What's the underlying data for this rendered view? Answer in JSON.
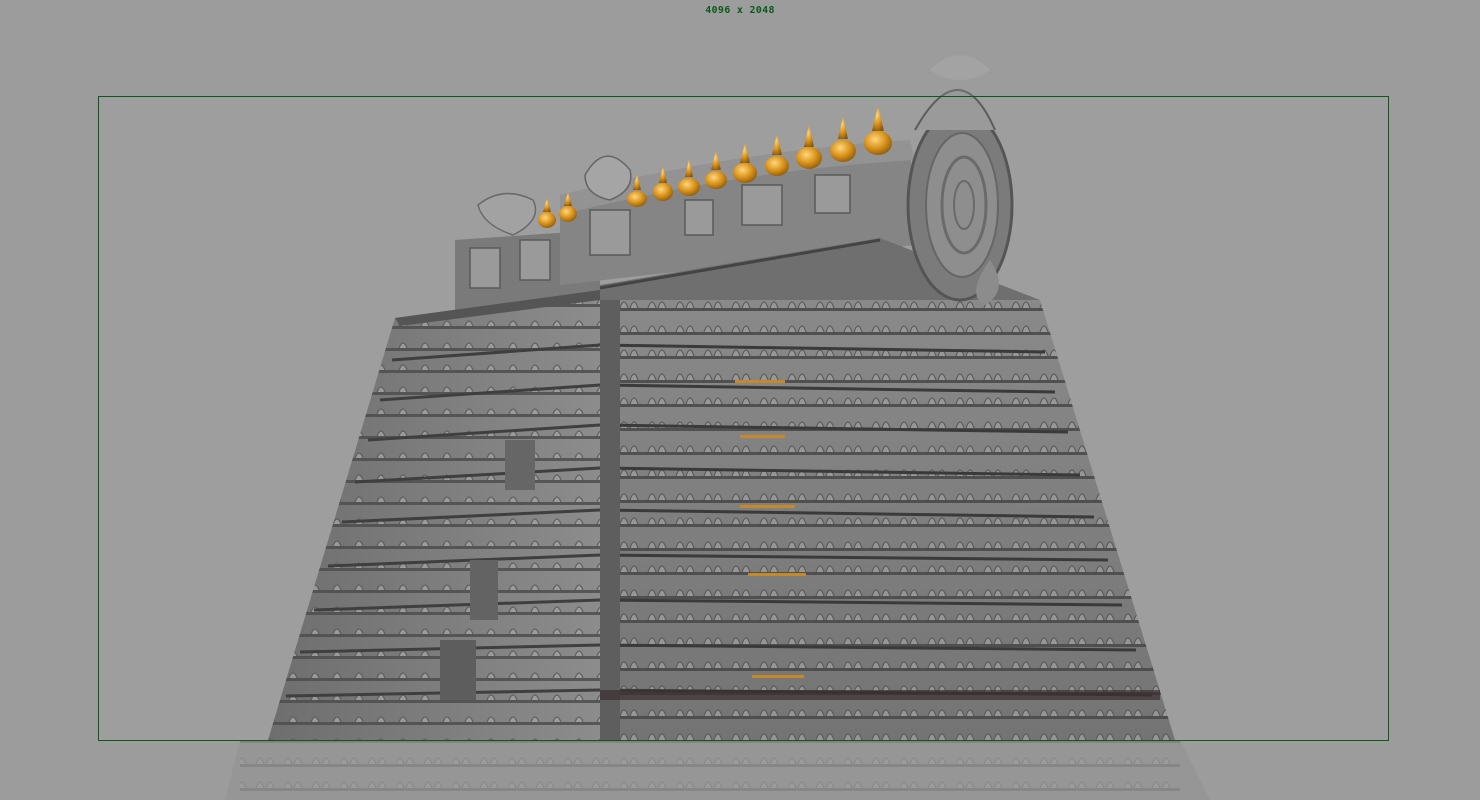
{
  "viewport": {
    "resolution_label": "4096 x 2048",
    "background_color": "#9e9e9e",
    "gate_color": "#0b5a1c"
  },
  "scene": {
    "subject": "temple-gopuram-model",
    "kalasa_color": "#d9921b",
    "stone_color": "#7d7d7d"
  }
}
